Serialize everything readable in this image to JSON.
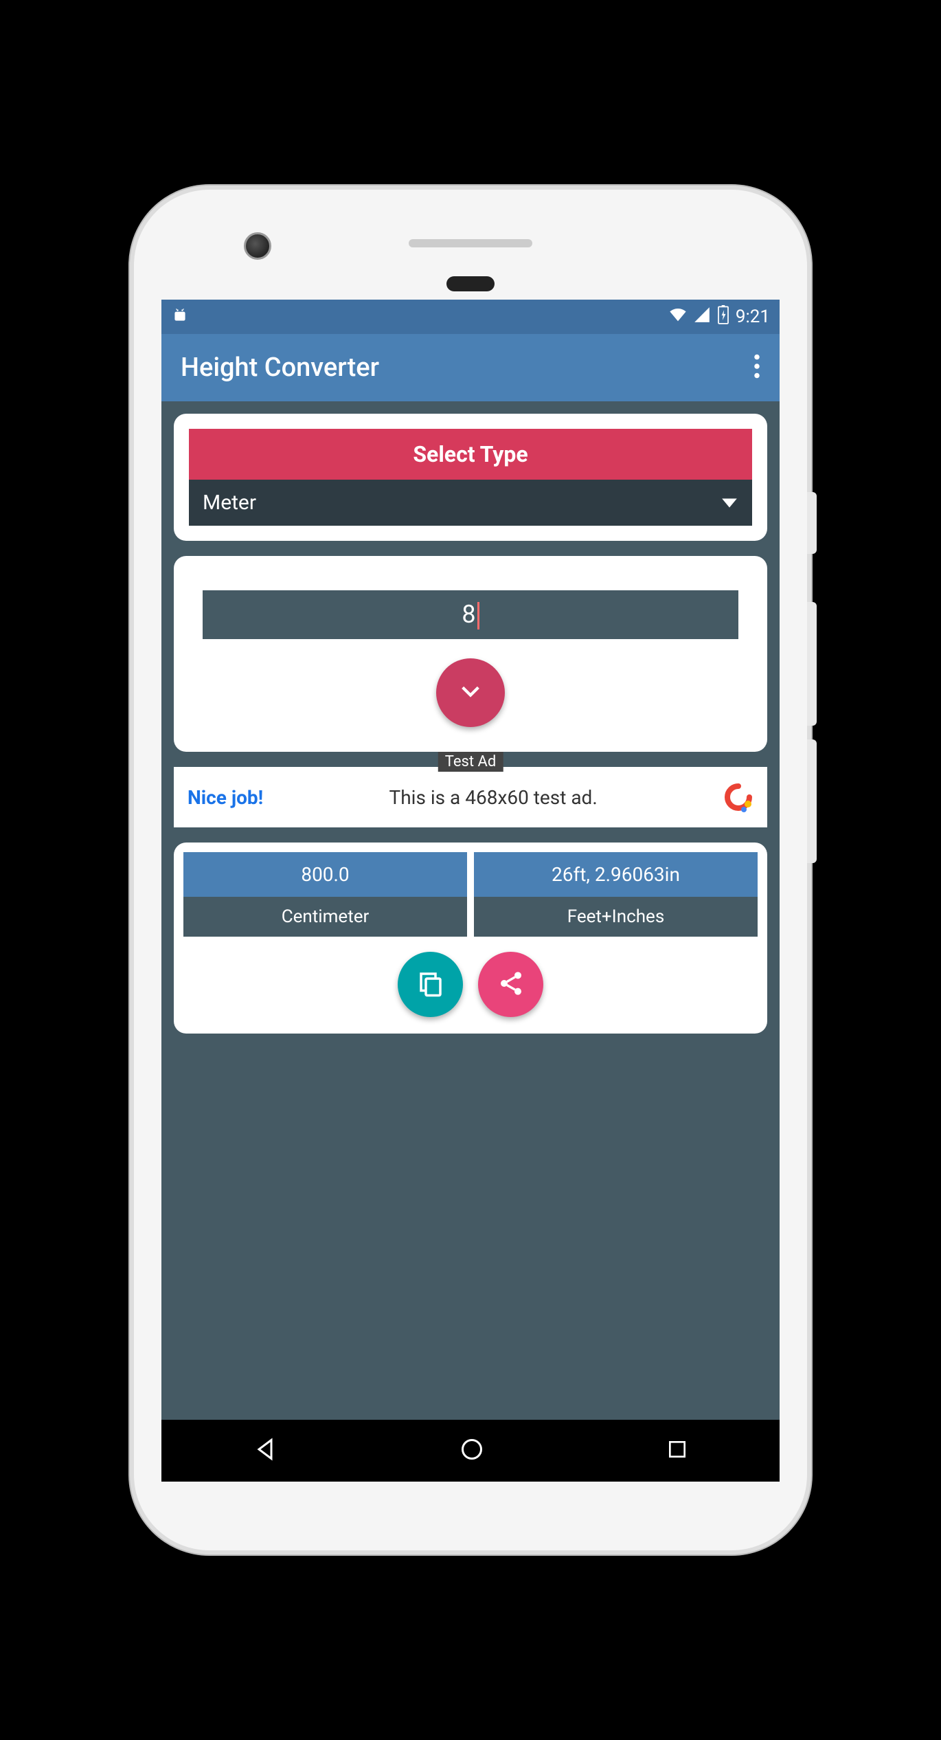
{
  "status": {
    "time": "9:21"
  },
  "app": {
    "title": "Height Converter"
  },
  "select": {
    "header": "Select Type",
    "value": "Meter"
  },
  "input": {
    "value": "8"
  },
  "ad": {
    "tag": "Test Ad",
    "nice": "Nice job!",
    "text": "This is a 468x60 test ad."
  },
  "results": [
    {
      "value": "800.0",
      "label": "Centimeter"
    },
    {
      "value": "26ft, 2.96063in",
      "label": "Feet+Inches"
    }
  ]
}
